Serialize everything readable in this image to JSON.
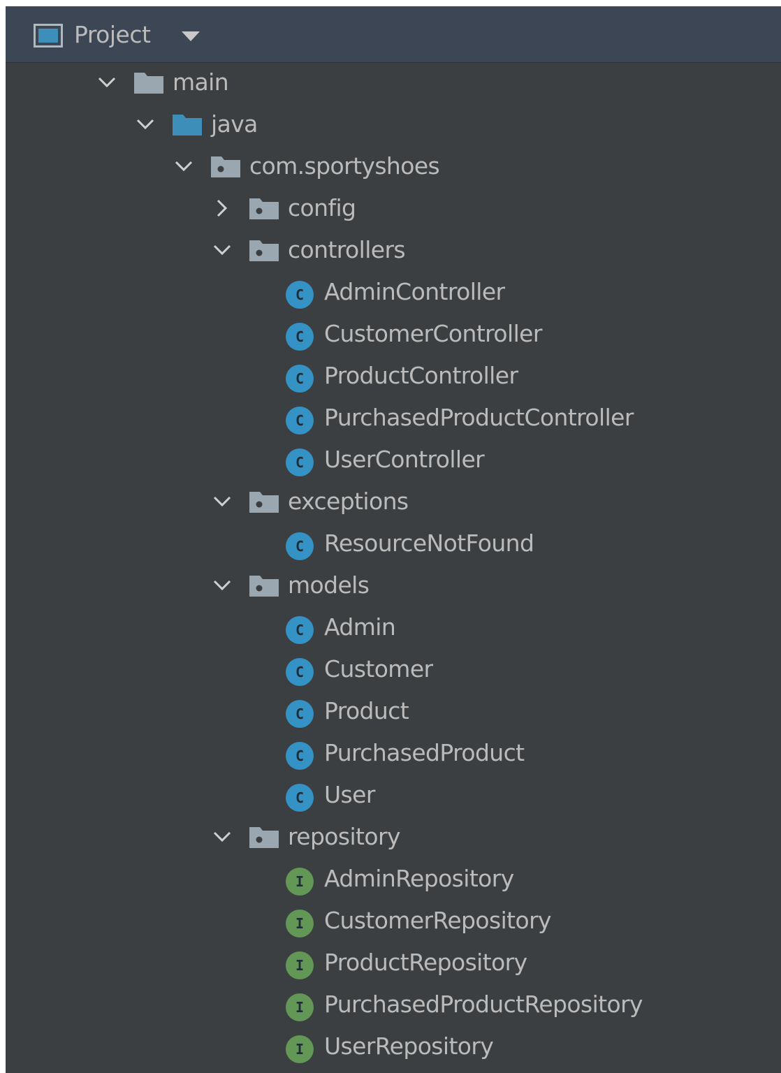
{
  "panel": {
    "title": "Project",
    "icon": "project-window-icon",
    "dropdown_icon": "triangle-down-icon",
    "colors": {
      "background": "#3c3f41",
      "header": "#3c4654",
      "text": "#bbbbbb",
      "class_icon": "#3592c4",
      "interface_icon": "#629755",
      "folder": "#9aa7b0",
      "source_folder": "#3d8eb9"
    }
  },
  "tree": [
    {
      "label": "main",
      "type": "folder",
      "icon": "folder-icon",
      "expanded": true
    },
    {
      "label": "java",
      "type": "source-folder",
      "icon": "source-folder-icon",
      "expanded": true
    },
    {
      "label": "com.sportyshoes",
      "type": "package",
      "icon": "package-icon",
      "expanded": true
    },
    {
      "label": "config",
      "type": "package",
      "icon": "package-icon",
      "expanded": false
    },
    {
      "label": "controllers",
      "type": "package",
      "icon": "package-icon",
      "expanded": true
    },
    {
      "label": "AdminController",
      "type": "class",
      "icon": "class-icon",
      "glyph": "C"
    },
    {
      "label": "CustomerController",
      "type": "class",
      "icon": "class-icon",
      "glyph": "C"
    },
    {
      "label": "ProductController",
      "type": "class",
      "icon": "class-icon",
      "glyph": "C"
    },
    {
      "label": "PurchasedProductController",
      "type": "class",
      "icon": "class-icon",
      "glyph": "C"
    },
    {
      "label": "UserController",
      "type": "class",
      "icon": "class-icon",
      "glyph": "C"
    },
    {
      "label": "exceptions",
      "type": "package",
      "icon": "package-icon",
      "expanded": true
    },
    {
      "label": "ResourceNotFound",
      "type": "class",
      "icon": "class-icon",
      "glyph": "C"
    },
    {
      "label": "models",
      "type": "package",
      "icon": "package-icon",
      "expanded": true
    },
    {
      "label": "Admin",
      "type": "class",
      "icon": "class-icon",
      "glyph": "C"
    },
    {
      "label": "Customer",
      "type": "class",
      "icon": "class-icon",
      "glyph": "C"
    },
    {
      "label": "Product",
      "type": "class",
      "icon": "class-icon",
      "glyph": "C"
    },
    {
      "label": "PurchasedProduct",
      "type": "class",
      "icon": "class-icon",
      "glyph": "C"
    },
    {
      "label": "User",
      "type": "class",
      "icon": "class-icon",
      "glyph": "C"
    },
    {
      "label": "repository",
      "type": "package",
      "icon": "package-icon",
      "expanded": true
    },
    {
      "label": "AdminRepository",
      "type": "interface",
      "icon": "interface-icon",
      "glyph": "I"
    },
    {
      "label": "CustomerRepository",
      "type": "interface",
      "icon": "interface-icon",
      "glyph": "I"
    },
    {
      "label": "ProductRepository",
      "type": "interface",
      "icon": "interface-icon",
      "glyph": "I"
    },
    {
      "label": "PurchasedProductRepository",
      "type": "interface",
      "icon": "interface-icon",
      "glyph": "I"
    },
    {
      "label": "UserRepository",
      "type": "interface",
      "icon": "interface-icon",
      "glyph": "I"
    }
  ]
}
